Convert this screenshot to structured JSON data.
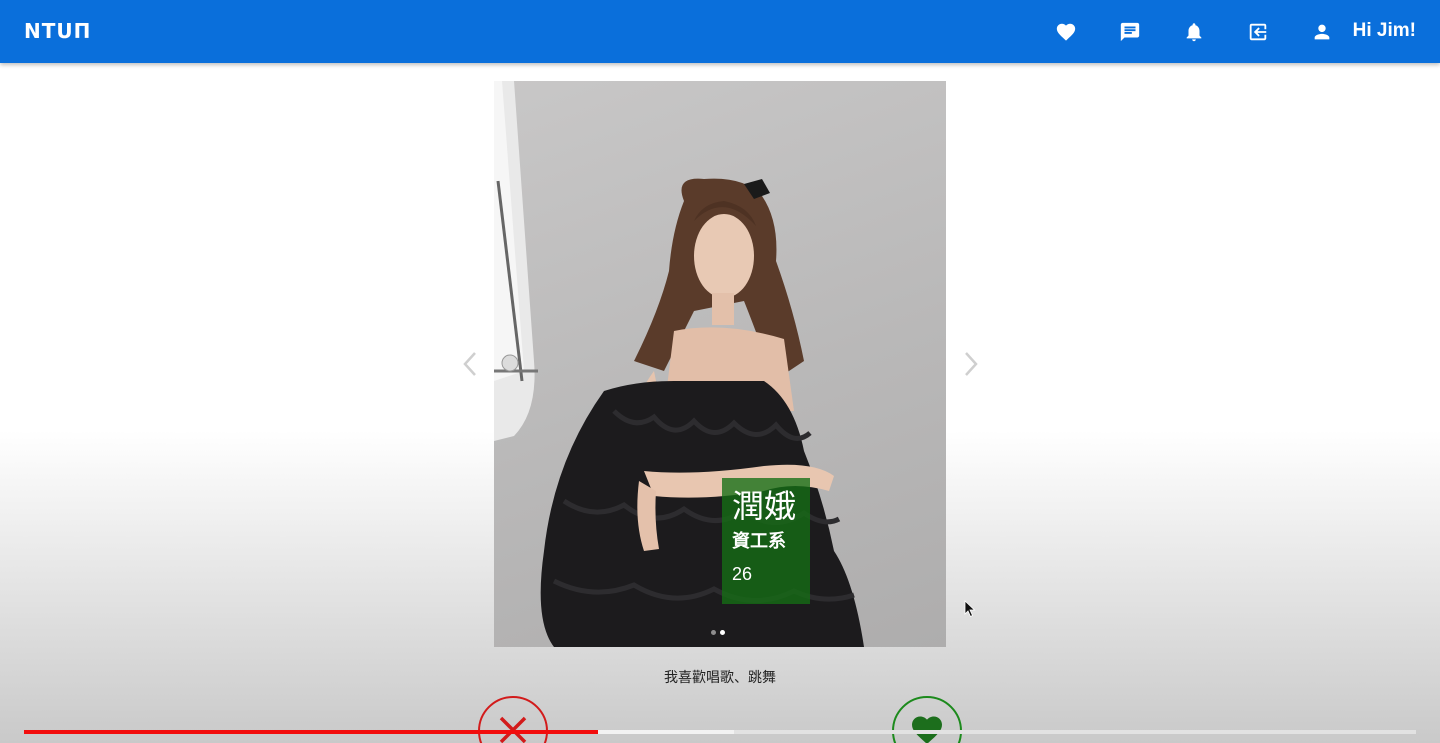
{
  "app": {
    "logo": "NTUΠ",
    "greeting": "Hi Jim!",
    "brand_color": "#0a6fdb"
  },
  "nav": {
    "icons": [
      "heart-icon",
      "chat-icon",
      "bell-icon",
      "logout-icon",
      "user-icon"
    ]
  },
  "profile": {
    "name": "潤娥",
    "department": "資工系",
    "age": "26",
    "bio": "我喜歡唱歌、跳舞",
    "photo_count": 2,
    "active_photo": 2
  },
  "actions": {
    "dislike_icon": "close-icon",
    "like_icon": "heart-icon",
    "dislike_color": "#d21b1b",
    "like_color": "#1c8a1c"
  },
  "video_progress": {
    "played_fraction": 0.412,
    "buffered_fraction": 0.51,
    "played_color": "#f20d0d"
  }
}
